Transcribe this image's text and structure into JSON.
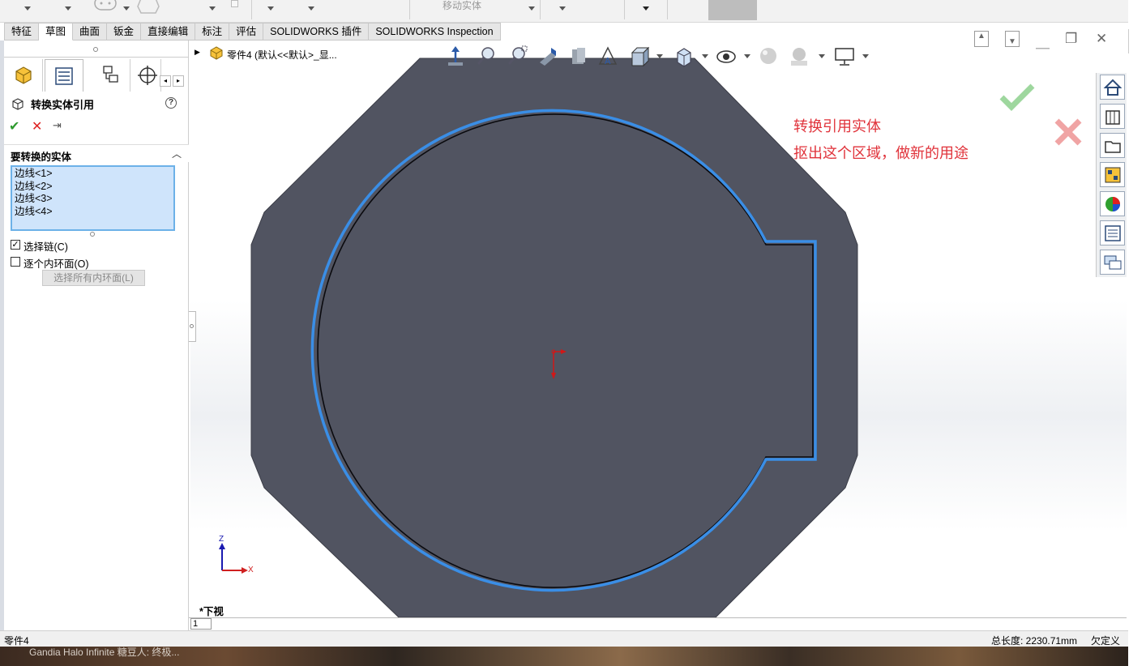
{
  "toolbar": {
    "move_entity_label": "移动实体"
  },
  "tabs": [
    {
      "label": "特征"
    },
    {
      "label": "草图"
    },
    {
      "label": "曲面"
    },
    {
      "label": "钣金"
    },
    {
      "label": "直接编辑"
    },
    {
      "label": "标注"
    },
    {
      "label": "评估"
    },
    {
      "label": "SOLIDWORKS 插件"
    },
    {
      "label": "SOLIDWORKS Inspection"
    }
  ],
  "active_tab": "草图",
  "property_manager": {
    "title": "转换实体引用",
    "help_label": "?",
    "ok_label": "✔",
    "cancel_label": "✕",
    "pin_label": "⇥",
    "section_title": "要转换的实体",
    "entities": [
      "边线<1>",
      "边线<2>",
      "边线<3>",
      "边线<4>"
    ],
    "select_chain": {
      "label": "选择链(C)",
      "checked": true
    },
    "each_inner_loop": {
      "label": "逐个内环面(O)",
      "checked": false
    },
    "select_all_inner_button": "选择所有内环面(L)"
  },
  "feature_tree": {
    "text": "零件4  (默认<<默认>_显..."
  },
  "annotations": {
    "line1": "转换引用实体",
    "line2": "抠出这个区域，做新的用途"
  },
  "view": {
    "label": "*下视",
    "axis_z": "Z",
    "axis_x": "X"
  },
  "sheet_tab": "1",
  "status": {
    "document": "零件4",
    "total_length": "总长度: 2230.71mm",
    "definition": "欠定义"
  },
  "taskbar": {
    "text": "Gandia    Halo Infinite  糖豆人: 终极..."
  },
  "colors": {
    "model_face": "#515461",
    "selection_edge": "#3a8ee6",
    "annotation_red": "#e0323a",
    "ok_green": "#2f9a2f",
    "cancel_red": "#dd2222"
  }
}
